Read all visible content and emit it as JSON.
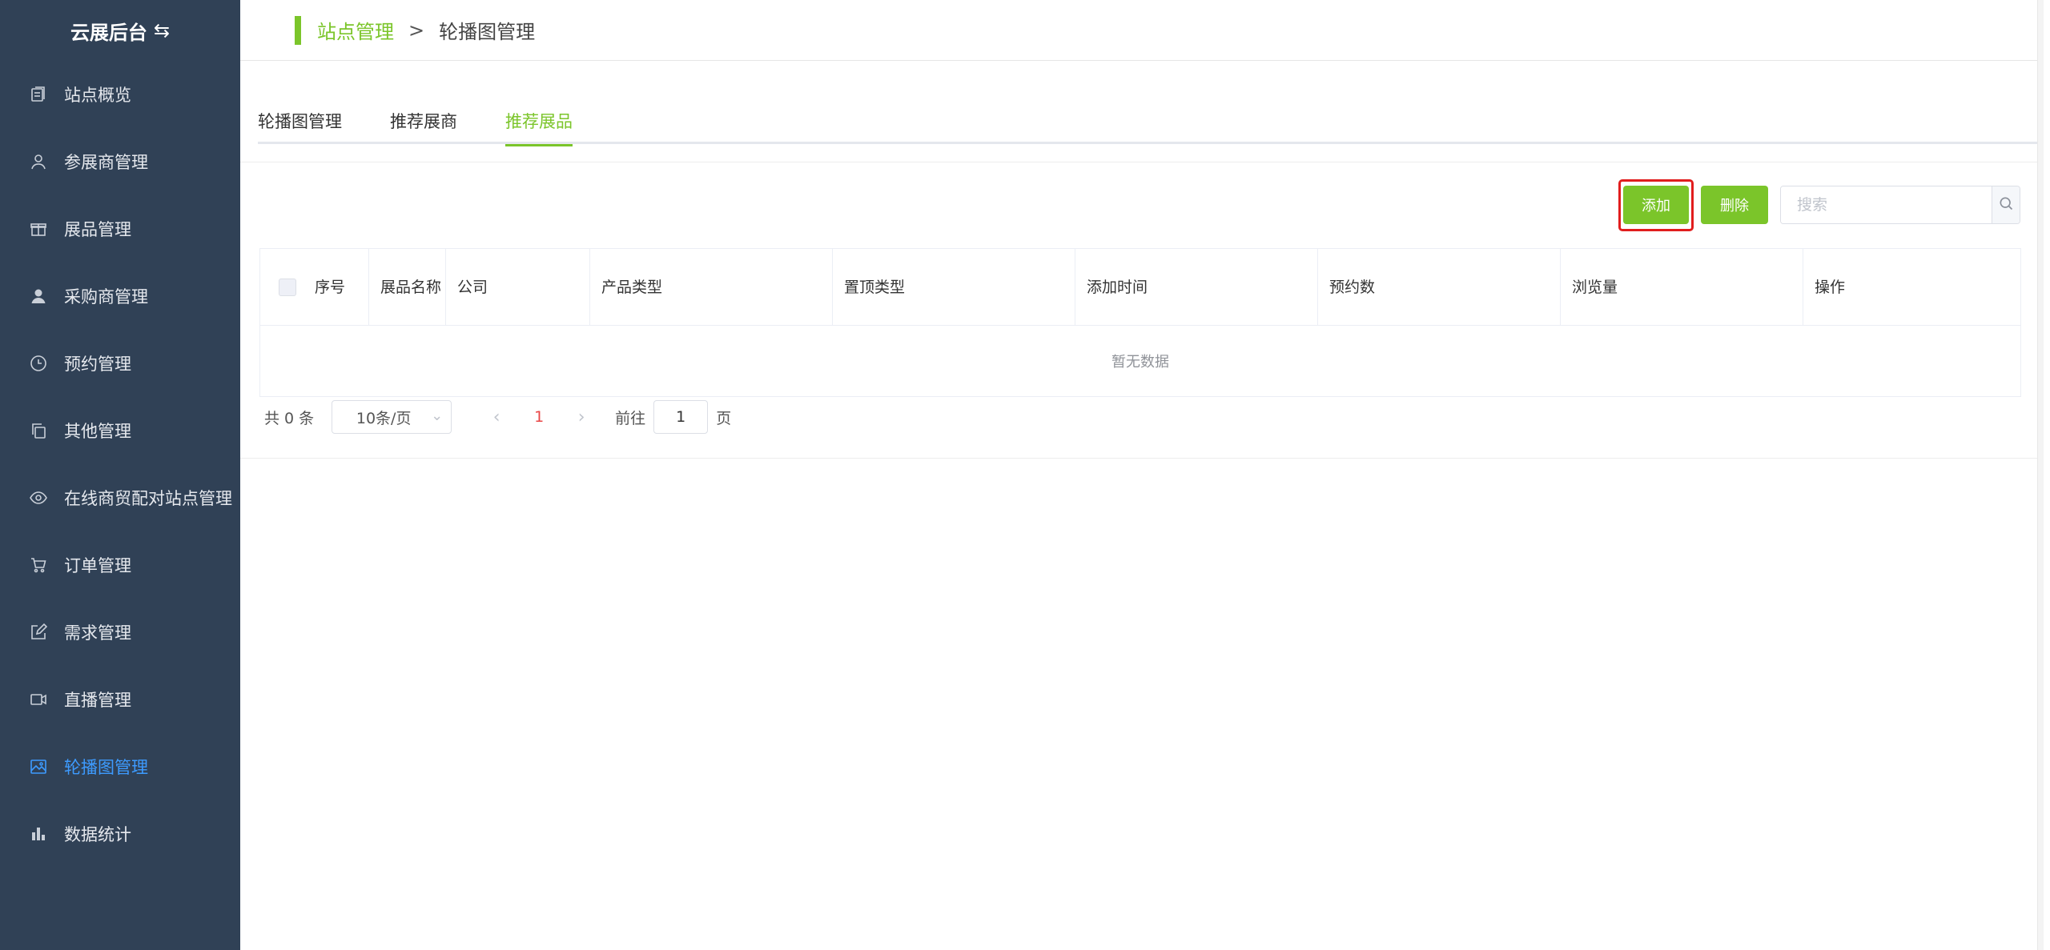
{
  "app": {
    "title": "云展后台",
    "switch_icon": "swap-icon"
  },
  "sidebar": {
    "items": [
      {
        "label": "站点概览",
        "icon": "document-icon"
      },
      {
        "label": "参展商管理",
        "icon": "user-icon"
      },
      {
        "label": "展品管理",
        "icon": "gift-icon"
      },
      {
        "label": "采购商管理",
        "icon": "user-filled-icon"
      },
      {
        "label": "预约管理",
        "icon": "clock-icon"
      },
      {
        "label": "其他管理",
        "icon": "copy-icon"
      },
      {
        "label": "在线商贸配对站点管理",
        "icon": "eye-icon"
      },
      {
        "label": "订单管理",
        "icon": "cart-icon"
      },
      {
        "label": "需求管理",
        "icon": "edit-icon"
      },
      {
        "label": "直播管理",
        "icon": "video-icon"
      },
      {
        "label": "轮播图管理",
        "icon": "picture-icon",
        "active": true
      },
      {
        "label": "数据统计",
        "icon": "bar-chart-icon"
      }
    ],
    "active_color": "#3d9bff"
  },
  "breadcrumb": {
    "parent": "站点管理",
    "separator": ">",
    "current": "轮播图管理"
  },
  "tabs": [
    {
      "label": "轮播图管理",
      "active": false
    },
    {
      "label": "推荐展商",
      "active": false
    },
    {
      "label": "推荐展品",
      "active": true
    }
  ],
  "toolbar": {
    "add_label": "添加",
    "delete_label": "删除",
    "search_placeholder": "搜索"
  },
  "table": {
    "columns": [
      "序号",
      "展品名称",
      "公司",
      "产品类型",
      "置顶类型",
      "添加时间",
      "预约数",
      "浏览量",
      "操作"
    ],
    "empty_text": "暂无数据"
  },
  "pagination": {
    "total_text": "共 0 条",
    "page_size": "10条/页",
    "current_page": "1",
    "goto_label": "前往",
    "goto_value": "1",
    "page_suffix": "页"
  },
  "colors": {
    "brand": "#7bc52a",
    "sidebar_bg": "#304156",
    "highlight": "#e11d1d"
  }
}
